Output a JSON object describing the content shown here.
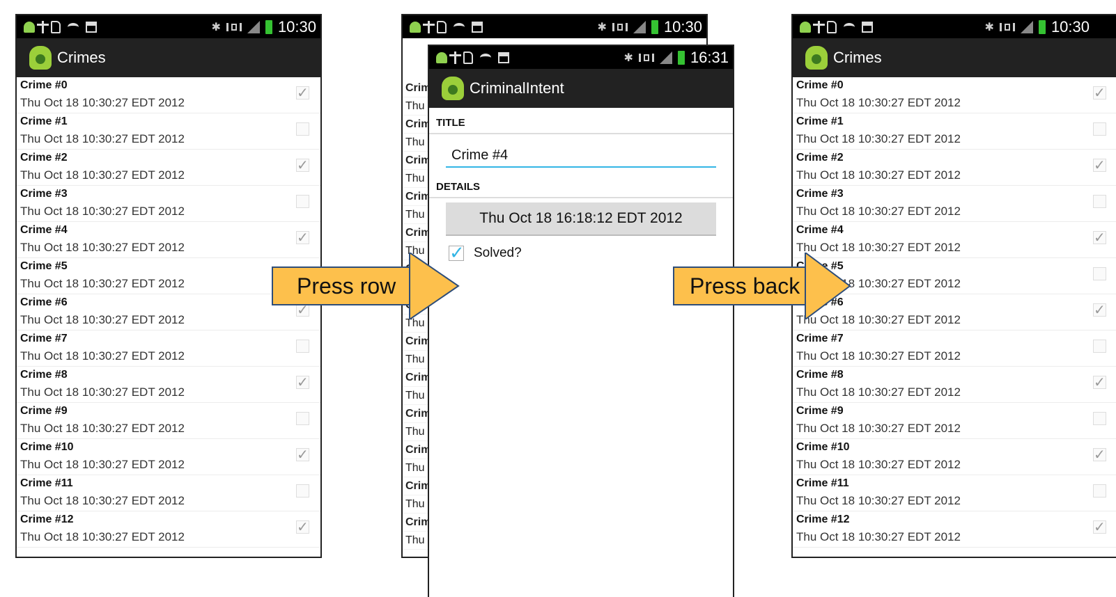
{
  "status": {
    "time_main": "10:30",
    "time_detail": "16:31"
  },
  "list_screen": {
    "title": "Crimes",
    "crimes": [
      {
        "title": "Crime #0",
        "date": "Thu Oct 18 10:30:27 EDT 2012",
        "solved": true
      },
      {
        "title": "Crime #1",
        "date": "Thu Oct 18 10:30:27 EDT 2012",
        "solved": false
      },
      {
        "title": "Crime #2",
        "date": "Thu Oct 18 10:30:27 EDT 2012",
        "solved": true
      },
      {
        "title": "Crime #3",
        "date": "Thu Oct 18 10:30:27 EDT 2012",
        "solved": false
      },
      {
        "title": "Crime #4",
        "date": "Thu Oct 18 10:30:27 EDT 2012",
        "solved": true
      },
      {
        "title": "Crime #5",
        "date": "Thu Oct 18 10:30:27 EDT 2012",
        "solved": false
      },
      {
        "title": "Crime #6",
        "date": "Thu Oct 18 10:30:27 EDT 2012",
        "solved": true
      },
      {
        "title": "Crime #7",
        "date": "Thu Oct 18 10:30:27 EDT 2012",
        "solved": false
      },
      {
        "title": "Crime #8",
        "date": "Thu Oct 18 10:30:27 EDT 2012",
        "solved": true
      },
      {
        "title": "Crime #9",
        "date": "Thu Oct 18 10:30:27 EDT 2012",
        "solved": false
      },
      {
        "title": "Crime #10",
        "date": "Thu Oct 18 10:30:27 EDT 2012",
        "solved": true
      },
      {
        "title": "Crime #11",
        "date": "Thu Oct 18 10:30:27 EDT 2012",
        "solved": false
      },
      {
        "title": "Crime #12",
        "date": "Thu Oct 18 10:30:27 EDT 2012",
        "solved": true
      }
    ]
  },
  "detail_screen": {
    "app_title": "CriminalIntent",
    "title_section": "TITLE",
    "title_value": "Crime #4",
    "details_section": "DETAILS",
    "date_button": "Thu Oct 18 16:18:12 EDT 2012",
    "solved_label": "Solved?",
    "solved": true
  },
  "peek_rows": [
    "Crim",
    "Thu",
    "Crim",
    "Thu",
    "Crim",
    "Thu",
    "Crim",
    "Thu",
    "Crim",
    "Thu",
    "Crim",
    "Thu",
    "Crim",
    "Thu",
    "Crim",
    "Thu",
    "Crim",
    "Thu",
    "Crim",
    "Thu",
    "Crim",
    "Thu",
    "Crim",
    "Thu",
    "Crim",
    "Thu"
  ],
  "arrows": {
    "first": "Press row",
    "second": "Press back"
  },
  "colors": {
    "arrow_fill": "#fdc04c",
    "arrow_stroke": "#2e4d79",
    "accent": "#33b5e5",
    "battery": "#35c232"
  }
}
